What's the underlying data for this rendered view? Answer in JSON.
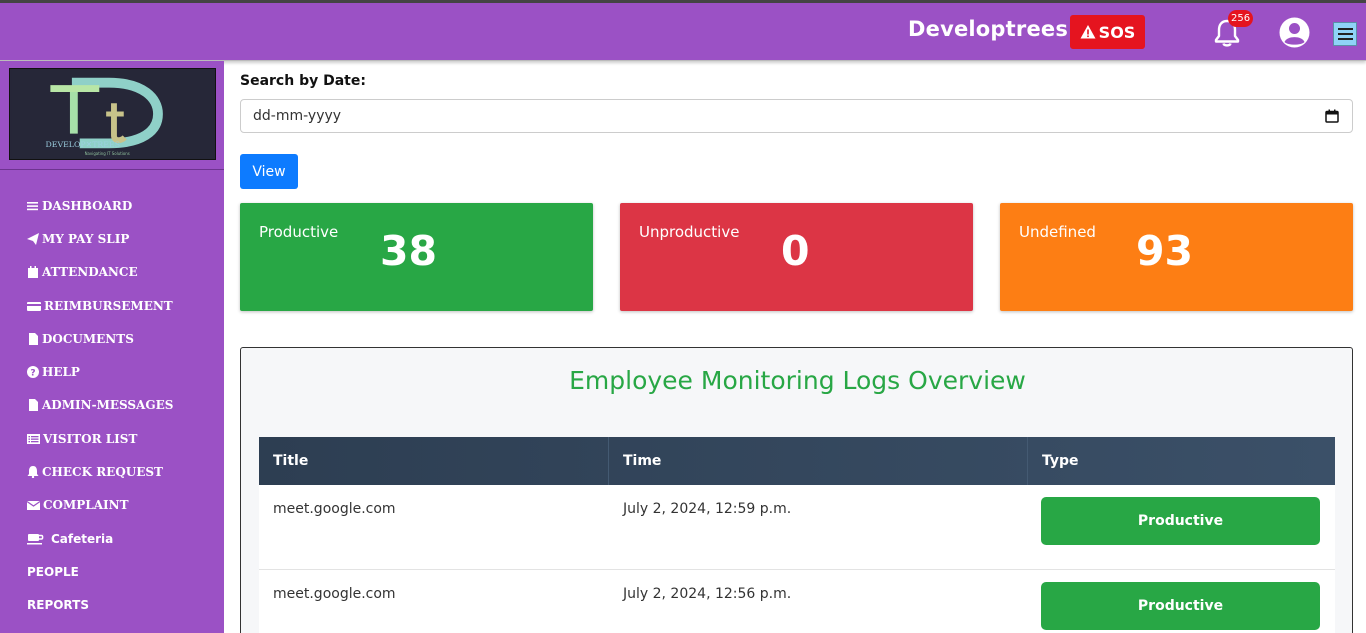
{
  "header": {
    "brand": "Developtrees",
    "sos_label": "SOS",
    "notification_count": "256"
  },
  "sidebar": {
    "logo_text": "DEVELOP TREES",
    "logo_tagline": "Navigating IT Solutions",
    "items": [
      {
        "label": "DASHBOARD",
        "icon": "bars-icon"
      },
      {
        "label": "MY PAY SLIP",
        "icon": "paper-plane-icon"
      },
      {
        "label": "ATTENDANCE",
        "icon": "calendar-icon"
      },
      {
        "label": "REIMBURSEMENT",
        "icon": "credit-card-icon"
      },
      {
        "label": "DOCUMENTS",
        "icon": "file-icon"
      },
      {
        "label": "HELP",
        "icon": "question-circle-icon"
      },
      {
        "label": "ADMIN-MESSAGES",
        "icon": "file-icon"
      },
      {
        "label": "VISITOR LIST",
        "icon": "list-icon"
      },
      {
        "label": "CHECK REQUEST",
        "icon": "bell-icon"
      },
      {
        "label": "COMPLAINT",
        "icon": "envelope-icon"
      },
      {
        "label": "Cafeteria",
        "icon": "coffee-icon"
      },
      {
        "label": "PEOPLE",
        "icon": ""
      },
      {
        "label": "REPORTS",
        "icon": ""
      }
    ]
  },
  "search": {
    "label": "Search by Date:",
    "placeholder": "dd-mm-yyyy",
    "button": "View"
  },
  "stats": {
    "productive": {
      "label": "Productive",
      "value": "38",
      "color": "#28a745"
    },
    "unproductive": {
      "label": "Unproductive",
      "value": "0",
      "color": "#dc3545"
    },
    "undefined": {
      "label": "Undefined",
      "value": "93",
      "color": "#fd7e14"
    }
  },
  "logs": {
    "title": "Employee Monitoring Logs Overview",
    "columns": [
      "Title",
      "Time",
      "Type"
    ],
    "rows": [
      {
        "title": "meet.google.com",
        "time": "July 2, 2024, 12:59 p.m.",
        "type": "Productive"
      },
      {
        "title": "meet.google.com",
        "time": "July 2, 2024, 12:56 p.m.",
        "type": "Productive"
      }
    ]
  }
}
